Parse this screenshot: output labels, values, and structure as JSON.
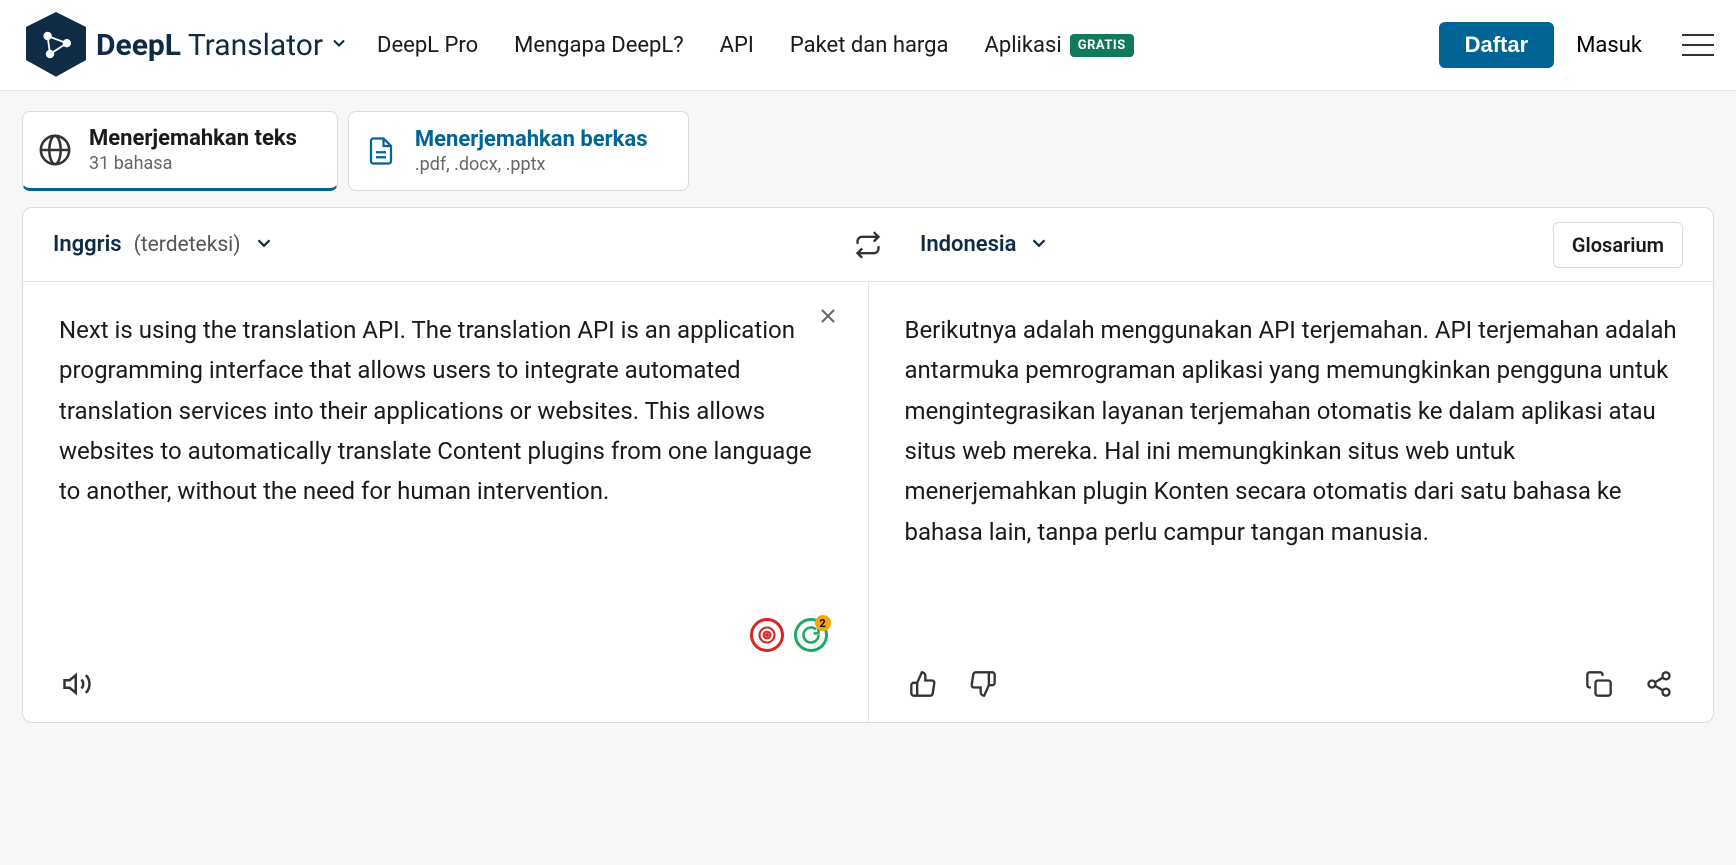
{
  "header": {
    "brand_bold": "DeepL",
    "brand_rest": " Translator",
    "nav": {
      "pro": "DeepL Pro",
      "why": "Mengapa DeepL?",
      "api": "API",
      "pricing": "Paket dan harga",
      "apps": "Aplikasi",
      "free_badge": "GRATIS"
    },
    "signup": "Daftar",
    "login": "Masuk"
  },
  "tabs": {
    "text": {
      "title": "Menerjemahkan teks",
      "subtitle": "31 bahasa"
    },
    "files": {
      "title": "Menerjemahkan berkas",
      "subtitle": ".pdf, .docx, .pptx"
    }
  },
  "languages": {
    "source_name": "Inggris",
    "source_detected": "(terdeteksi)",
    "target_name": "Indonesia",
    "glossary": "Glosarium"
  },
  "source_text": "Next is using the translation API. The translation API is an application programming interface that allows users to integrate automated translation services into their applications or websites. This allows websites to automatically translate Content plugins from one language to another, without the need for human intervention.",
  "target_text": "Berikutnya adalah menggunakan API terjemahan. API terjemahan adalah antarmuka pemrograman aplikasi yang memungkinkan pengguna untuk mengintegrasikan layanan terjemahan otomatis ke dalam aplikasi atau situs web mereka. Hal ini memungkinkan situs web untuk menerjemahkan plugin Konten secara otomatis dari satu bahasa ke bahasa lain, tanpa perlu campur tangan manusia.",
  "grammarly_badge": "2"
}
